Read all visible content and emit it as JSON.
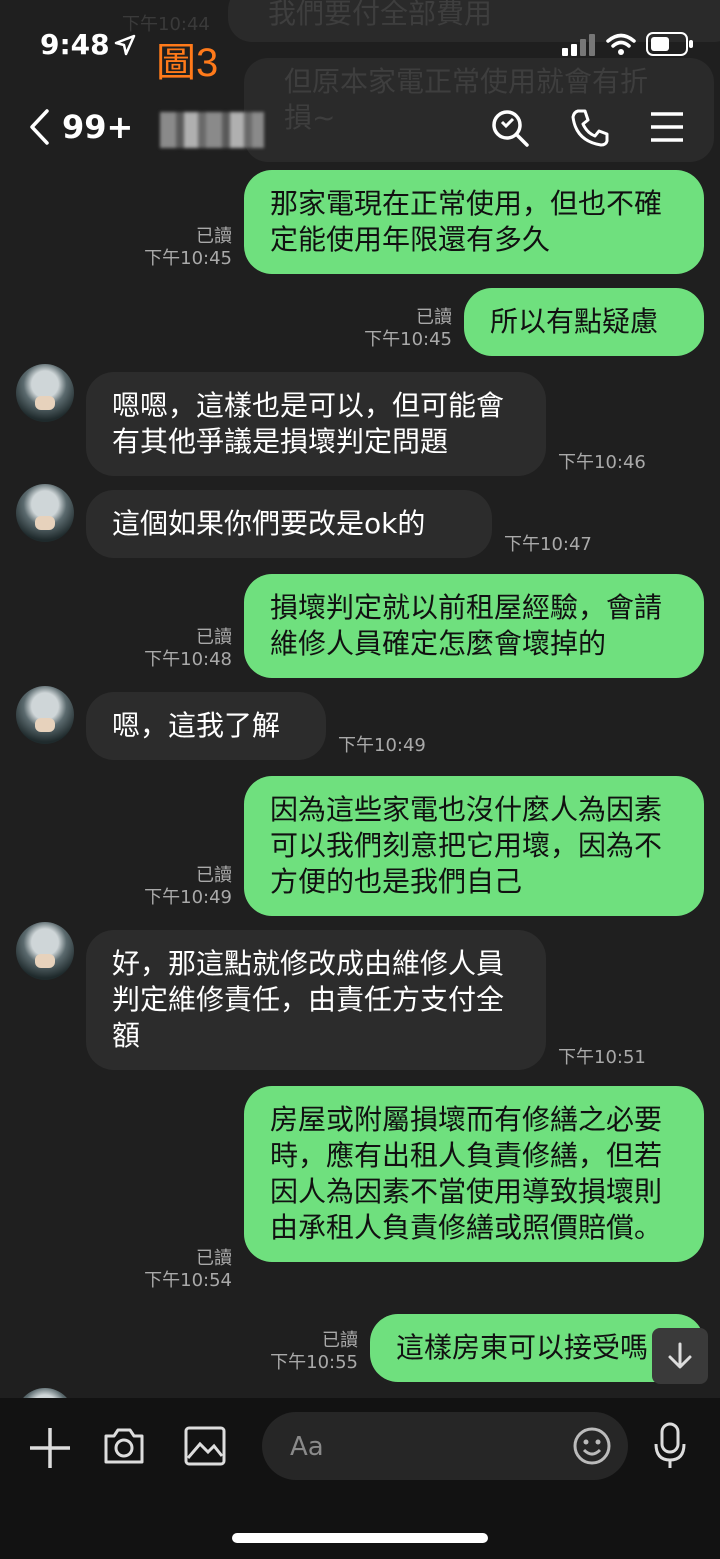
{
  "status_bar": {
    "time": "9:48"
  },
  "overlay": {
    "figure_label": "圖3"
  },
  "header": {
    "unread_count": "99+"
  },
  "ghost_messages": [
    "我們要付全部費用",
    "但原本家電正常使用就會有折損~"
  ],
  "ghost_time": "下午10:44",
  "read_label": "已讀",
  "messages": [
    {
      "dir": "out",
      "text": "那家電現在正常使用，但也不確定能使用年限還有多久",
      "time": "下午10:45"
    },
    {
      "dir": "out",
      "text": "所以有點疑慮",
      "time": "下午10:45"
    },
    {
      "dir": "in",
      "text": "嗯嗯，這樣也是可以，但可能會有其他爭議是損壞判定問題",
      "time": "下午10:46"
    },
    {
      "dir": "in",
      "text": "這個如果你們要改是ok的",
      "time": "下午10:47"
    },
    {
      "dir": "out",
      "text": "損壞判定就以前租屋經驗，會請維修人員確定怎麼會壞掉的",
      "time": "下午10:48"
    },
    {
      "dir": "in",
      "text": "嗯，這我了解",
      "time": "下午10:49"
    },
    {
      "dir": "out",
      "text": "因為這些家電也沒什麼人為因素可以我們刻意把它用壞，因為不方便的也是我們自己",
      "time": "下午10:49"
    },
    {
      "dir": "in",
      "text": "好，那這點就修改成由維修人員判定維修責任，由責任方支付全額",
      "time": "下午10:51"
    },
    {
      "dir": "out",
      "text": "房屋或附屬損壞而有修繕之必要時，應有出租人負責修繕，但若因人為因素不當使用導致損壞則由承租人負責修繕或照價賠償。",
      "time": "下午10:54"
    },
    {
      "dir": "out",
      "text": "這樣房東可以接受嗎",
      "time": "下午10:55"
    }
  ],
  "composer": {
    "placeholder": "Aa"
  }
}
